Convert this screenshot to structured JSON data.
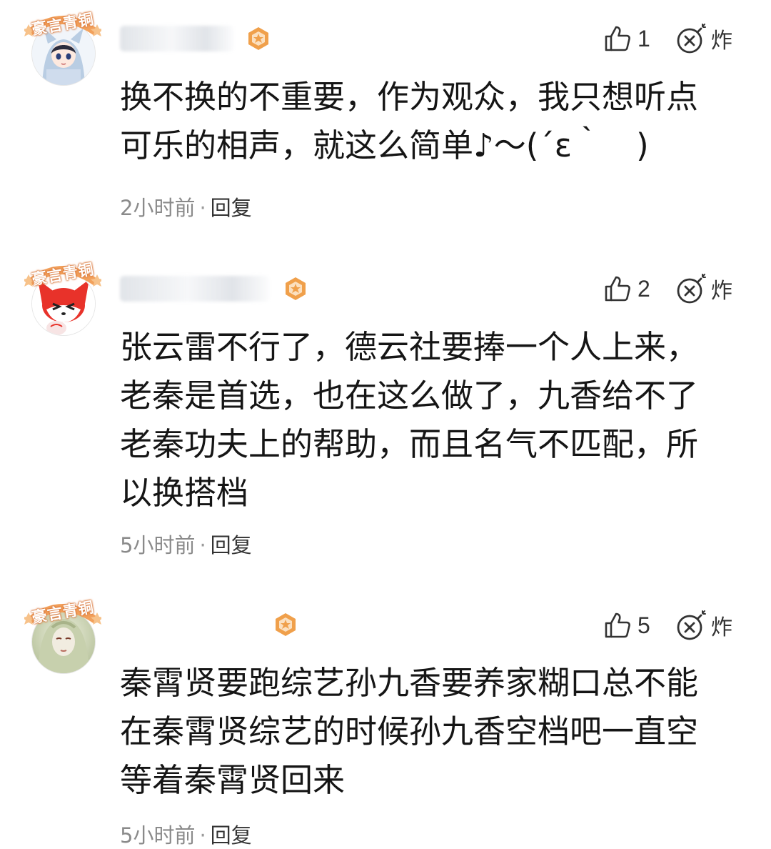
{
  "comments": [
    {
      "badge": "豪言青铜",
      "avatar": "blue-hooded-anime-girl",
      "likes": "1",
      "bomb_label": "炸",
      "lines": [
        "换不换的不重要，作为观众，我只想听点",
        "可乐的相声，就这么简单♪～(´ε｀　)"
      ],
      "time": "2小时前",
      "separator": "·",
      "reply": "回复"
    },
    {
      "badge": "豪言青铜",
      "avatar": "red-fox-cartoon",
      "likes": "2",
      "bomb_label": "炸",
      "lines": [
        "张云雷不行了，德云社要捧一个人上来，",
        "老秦是首选，也在这么做了，九香给不了",
        "老秦功夫上的帮助，而且名气不匹配，所",
        "以换搭档"
      ],
      "time": "5小时前",
      "separator": "·",
      "reply": "回复"
    },
    {
      "badge": "豪言青铜",
      "avatar": "green-haired-portrait",
      "likes": "5",
      "bomb_label": "炸",
      "lines": [
        "秦霄贤要跑综艺孙九香要养家糊口总不能",
        "在秦霄贤综艺的时候孙九香空档吧一直空",
        "等着秦霄贤回来"
      ],
      "time": "5小时前",
      "separator": "·",
      "reply": "回复"
    }
  ],
  "colors": {
    "badge": "#f2a15c",
    "vip": "#f0a04b",
    "text": "#151515",
    "meta": "#8a8a8a"
  }
}
